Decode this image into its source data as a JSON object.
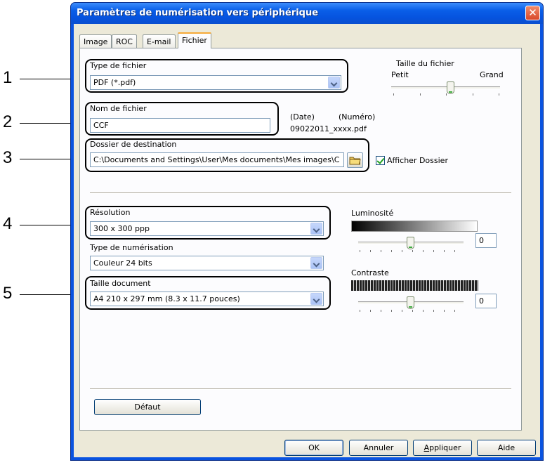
{
  "window": {
    "title": "Paramètres de numérisation vers périphérique",
    "close_glyph": "✕",
    "title_color": "#0a53e0"
  },
  "callouts": [
    "1",
    "2",
    "3",
    "4",
    "5"
  ],
  "tabs": [
    {
      "label": "Image"
    },
    {
      "label": "ROC"
    },
    {
      "label": "E-mail"
    },
    {
      "label": "Fichier",
      "active": true
    }
  ],
  "file_type": {
    "label": "Type de fichier",
    "value": "PDF (*.pdf)"
  },
  "file_size": {
    "label": "Taille du fichier",
    "min_label": "Petit",
    "max_label": "Grand",
    "level": 0.55
  },
  "file_name": {
    "label": "Nom de fichier",
    "value": "CCF",
    "date_label": "(Date)",
    "number_label": "(Numéro)",
    "example": "09022011_xxxx.pdf"
  },
  "destination": {
    "label": "Dossier de destination",
    "value": "C:\\Documents and Settings\\User\\Mes documents\\Mes images\\C",
    "folder_icon": "folder-icon",
    "show_folder_label": "Afficher Dossier",
    "show_folder_checked": true
  },
  "resolution": {
    "label": "Résolution",
    "value": "300 x 300 ppp"
  },
  "scan_type": {
    "label": "Type de numérisation",
    "value": "Couleur 24 bits"
  },
  "doc_size": {
    "label": "Taille document",
    "value": "A4 210 x 297 mm (8.3 x 11.7 pouces)"
  },
  "brightness": {
    "label": "Luminosité",
    "value": "0",
    "level": 0.5
  },
  "contrast": {
    "label": "Contraste",
    "value": "0",
    "level": 0.5
  },
  "default_button": "Défaut",
  "buttons": {
    "ok": "OK",
    "cancel": "Annuler",
    "apply": "Appliquer",
    "help": "Aide"
  }
}
